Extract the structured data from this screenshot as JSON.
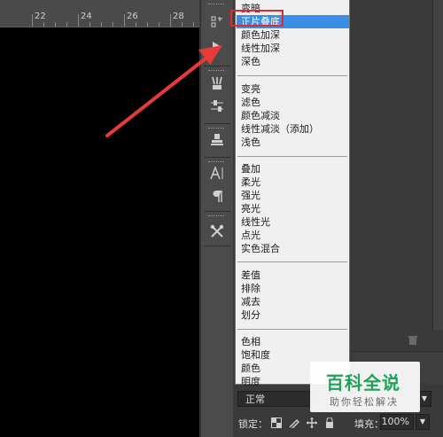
{
  "ruler": {
    "labels": [
      "22",
      "24",
      "26",
      "28"
    ]
  },
  "menu": {
    "groups": [
      [
        "变暗",
        "正片叠底",
        "颜色加深",
        "线性加深",
        "深色"
      ],
      [
        "变亮",
        "滤色",
        "颜色减淡",
        "线性减淡（添加）",
        "浅色"
      ],
      [
        "叠加",
        "柔光",
        "强光",
        "亮光",
        "线性光",
        "点光",
        "实色混合"
      ],
      [
        "差值",
        "排除",
        "减去",
        "划分"
      ],
      [
        "色相",
        "饱和度",
        "颜色",
        "明度"
      ]
    ],
    "selected": "正片叠底"
  },
  "blend_mode": {
    "value": "正常"
  },
  "lock": {
    "label": "锁定："
  },
  "fill": {
    "label": "填充：",
    "value": "100%"
  },
  "tools": [
    "history-icon",
    "play-icon",
    "brush-presets-icon",
    "adjust-sliders-icon",
    "clone-source-icon",
    "character-icon",
    "paragraph-icon",
    "tool-presets-icon"
  ],
  "watermark": {
    "title": "百科全说",
    "subtitle": "助你轻松解决"
  },
  "colors": {
    "selection": "#3a8ee6",
    "highlight_box": "#e32a2a",
    "arrow": "#e83a3a",
    "watermark": "#21a15a"
  }
}
